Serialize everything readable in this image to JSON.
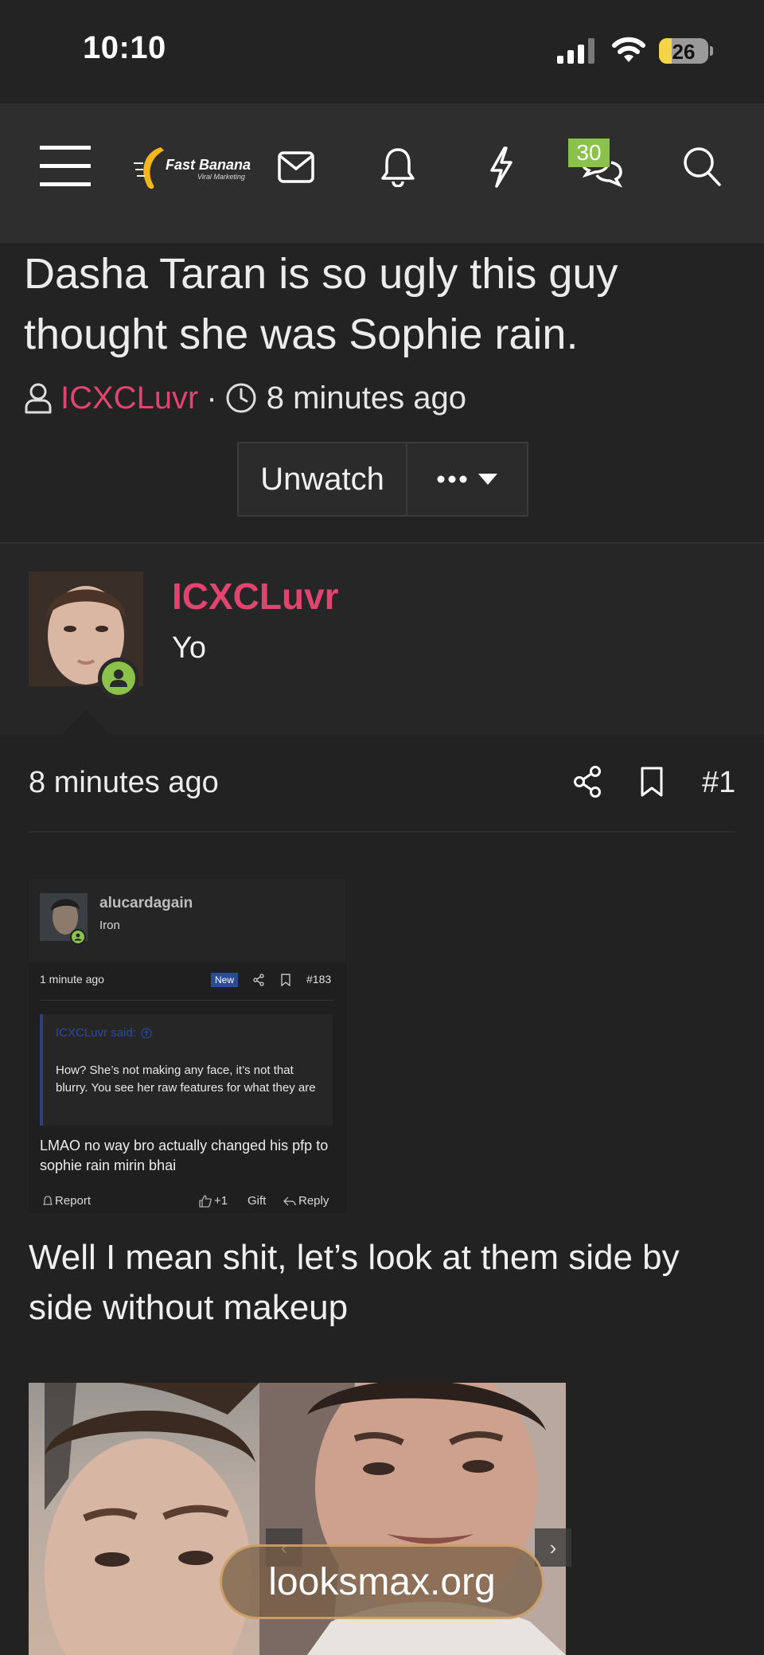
{
  "status_bar": {
    "time": "10:10",
    "battery": "26",
    "battery_level": 0.26
  },
  "nav": {
    "logo_text": "Fast Banana",
    "logo_subtext": "Viral Marketing",
    "chat_badge": "30"
  },
  "thread": {
    "title": "Dasha Taran is so ugly this guy thought she was Sophie rain.",
    "author": "ICXCLuvr",
    "separator": "·",
    "posted": "8 minutes ago",
    "unwatch_label": "Unwatch"
  },
  "post": {
    "username": "ICXCLuvr",
    "user_title": "Yo",
    "time": "8 minutes ago",
    "number": "#1",
    "body_text": "Well I mean shit, let’s look at them side by side without makeup"
  },
  "embedded": {
    "username": "alucardagain",
    "rank": "Iron",
    "time": "1 minute ago",
    "new_badge": "New",
    "number": "#183",
    "quote_author": "ICXCLuvr said:",
    "quote_text": "How? She’s not making any face, it’s not that blurry. You see her raw features for what they are",
    "reply": "LMAO no way bro actually changed his pfp to sophie rain mirin bhai",
    "report": "Report",
    "like_count": "+1",
    "gift": "Gift",
    "reply_label": "Reply"
  },
  "image": {
    "prev": "‹",
    "next": "›",
    "watermark": "looksmax.org"
  },
  "colors": {
    "accent": "#e0446f",
    "badge": "#8bc34a",
    "online": "#8bc34a"
  }
}
